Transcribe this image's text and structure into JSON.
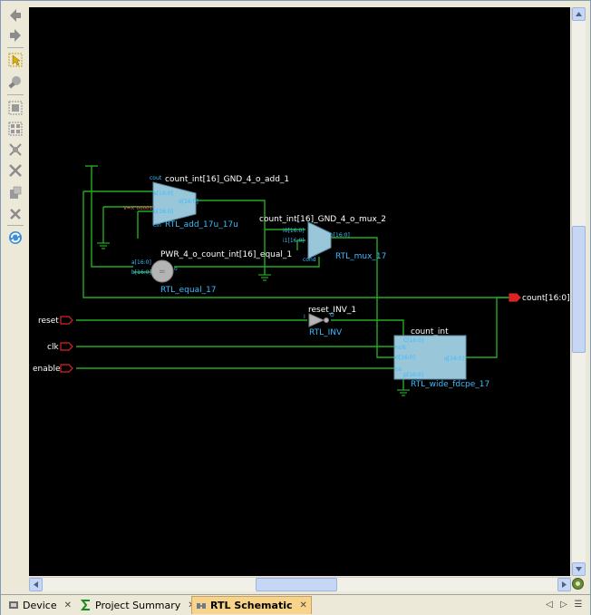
{
  "toolbar": {
    "icons": [
      "back-icon",
      "forward-icon",
      "select-icon",
      "zoom-icon",
      "zoom-fit-icon",
      "zoom-area-icon",
      "expand-icon",
      "collapse-icon",
      "regenerate-icon",
      "delete-icon",
      "refresh-icon"
    ]
  },
  "tabs": [
    {
      "label": "Device",
      "active": false,
      "icon": "device-icon"
    },
    {
      "label": "Project Summary",
      "active": false,
      "icon": "sigma-icon"
    },
    {
      "label": "RTL Schematic",
      "active": true,
      "icon": "schematic-icon"
    }
  ],
  "schematic": {
    "colors": {
      "wire": "#22aa22",
      "label": "#ffffff",
      "pin": "#3bbcff",
      "block": "#99c6d9",
      "port": "#dd2222"
    },
    "ports": {
      "reset": "reset",
      "clk": "clk",
      "enable": "enable",
      "count": "count[16:0]"
    },
    "add": {
      "instance": "count_int[16]_GND_4_o_add_1",
      "type": "RTL_add_17u_17u",
      "pin_cout": "cout",
      "pin_a": "a[16:0]",
      "pin_b": "b[16:0]",
      "pin_o": "o[16:0]",
      "pin_cin": "cin",
      "const": "V=X\"00001\""
    },
    "mux": {
      "instance": "count_int[16]_GND_4_o_mux_2",
      "type": "RTL_mux_17",
      "pin_i0": "i0[16:0]",
      "pin_i1": "i1[16:0]",
      "pin_o": "o[16:0]",
      "pin_cond": "cond"
    },
    "equal": {
      "instance": "PWR_4_o_count_int[16]_equal_1",
      "type": "RTL_equal_17",
      "pin_a": "a[16:0]",
      "pin_b": "b[16:0]",
      "pin_o": "o"
    },
    "inv": {
      "instance": "reset_INV_1",
      "type": "RTL_INV",
      "pin_i": "I",
      "pin_o": "O"
    },
    "reg": {
      "instance": "count_int",
      "type": "RTL_wide_fdcpe_17",
      "pin_c": "C[16:0]",
      "pin_nclk": "nclk",
      "pin_d": "d[16:0]",
      "pin_ce": "ce",
      "pin_q": "q[16:0]",
      "pin_p": "p[16:0]"
    }
  }
}
